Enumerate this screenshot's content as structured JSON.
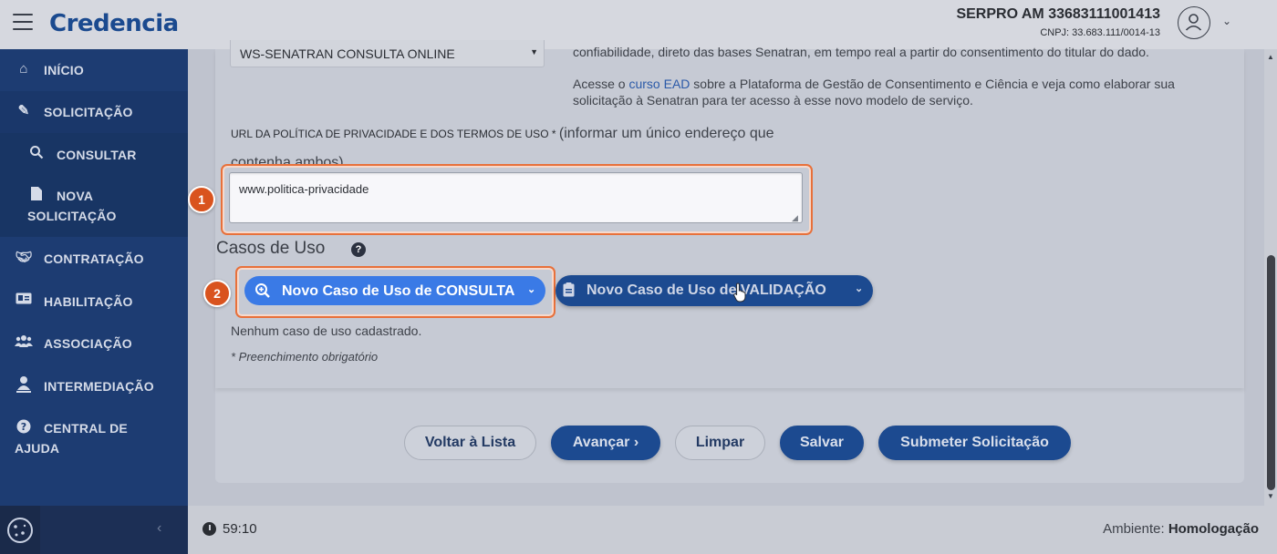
{
  "header": {
    "logo": "Credencia",
    "org_name": "SERPRO AM 33683111001413",
    "org_cnpj": "CNPJ: 33.683.111/0014-13"
  },
  "sidebar": {
    "items": [
      {
        "label": "INÍCIO",
        "icon": "home-icon"
      },
      {
        "label": "SOLICITAÇÃO",
        "icon": "edit-icon"
      },
      {
        "label": "CONSULTAR",
        "icon": "search-icon"
      },
      {
        "label": "NOVA SOLICITAÇÃO",
        "line1": "NOVA",
        "line2": "SOLICITAÇÃO",
        "icon": "file-icon"
      },
      {
        "label": "CONTRATAÇÃO",
        "icon": "handshake-icon"
      },
      {
        "label": "HABILITAÇÃO",
        "icon": "id-card-icon"
      },
      {
        "label": "ASSOCIAÇÃO",
        "icon": "users-icon"
      },
      {
        "label": "INTERMEDIAÇÃO",
        "icon": "user-network-icon"
      },
      {
        "label": "CENTRAL DE AJUDA",
        "line1": "CENTRAL DE",
        "line2": "AJUDA",
        "icon": "question-icon"
      }
    ]
  },
  "form": {
    "service_select_value": "WS-SENATRAN CONSULTA ONLINE",
    "info_line1": "confiabilidade, direto das bases Senatran, em tempo real a partir do consentimento do titular do dado.",
    "info_line2_before": "Acesse o ",
    "info_line2_link": "curso EAD",
    "info_line2_after": " sobre a Plataforma de Gestão de Consentimento e Ciência e veja como elaborar sua",
    "info_line3": "solicitação à Senatran para ter acesso à esse novo modelo de serviço.",
    "url_label": "URL DA POLÍTICA DE PRIVACIDADE E DOS TERMOS DE USO *",
    "url_hint_line1": "(informar um único endereço que",
    "url_hint_line2": "contenha ambos)",
    "url_value": "www.politica-privacidade",
    "section_title": "Casos de Uso",
    "btn_consulta": "Novo Caso de Uso de CONSULTA",
    "btn_validacao": "Novo Caso de Uso de VALIDAÇÃO",
    "empty_message": "Nenhum caso de uso cadastrado.",
    "required_note": "* Preenchimento obrigatório"
  },
  "badges": {
    "first": "1",
    "second": "2"
  },
  "actions": {
    "back": "Voltar à Lista",
    "next": "Avançar",
    "clear": "Limpar",
    "save": "Salvar",
    "submit": "Submeter Solicitação"
  },
  "footer": {
    "timer": "59:10",
    "env_label": "Ambiente:",
    "env_value": "Homologação"
  },
  "colors": {
    "sidebar": "#1d3c72",
    "primary": "#1c4a90",
    "highlight_button": "#3a7ae6",
    "annotation": "#d9531e"
  }
}
